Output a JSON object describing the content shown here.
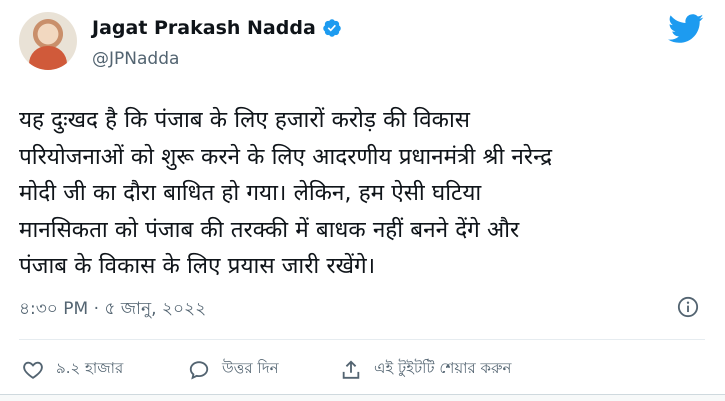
{
  "author": {
    "name": "Jagat Prakash Nadda",
    "handle": "@JPNadda"
  },
  "tweet": {
    "text": "यह दुःखद है कि पंजाब के लिए हजारों करोड़ की विकास\nपरियोजनाओं को शुरू करने के लिए आदरणीय प्रधानमंत्री श्री नरेन्द्र\nमोदी जी का दौरा बाधित हो गया। लेकिन, हम ऐसी घटिया\nमानसिकता को पंजाब की तरक्की में बाधक नहीं बनने देंगे और\nपंजाब के विकास के लिए प्रयास जारी रखेंगे।",
    "timestamp": "৪:৩০ PM · ৫ জানু, ২০২২"
  },
  "actions": {
    "likes_label": "৯.২ হাজার",
    "reply_label": "উত্তর দিন",
    "share_label": "এই টুইটটি শেয়ার করুন"
  },
  "colors": {
    "brand_blue": "#1d9bf0",
    "text_primary": "#0f1419",
    "text_secondary": "#536471"
  },
  "icons": {
    "brand": "twitter-bird-icon",
    "verified": "verified-badge-icon",
    "info": "info-icon",
    "like": "heart-icon",
    "reply": "reply-bubble-icon",
    "share": "share-icon"
  }
}
